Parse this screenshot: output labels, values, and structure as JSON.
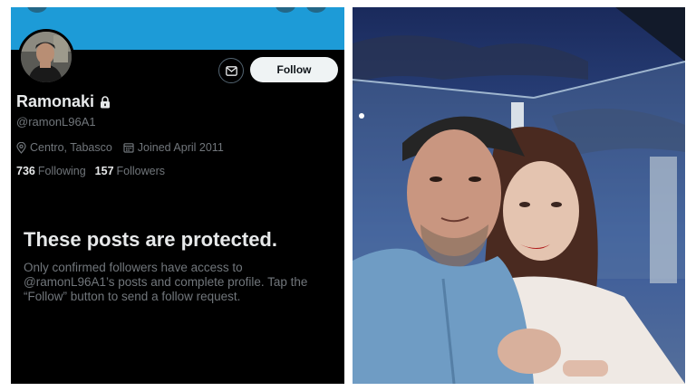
{
  "profile": {
    "display_name": "Ramonaki",
    "handle": "@ramonL96A1",
    "location": "Centro, Tabasco",
    "joined": "Joined April 2011",
    "following_count": "736",
    "following_label": "Following",
    "followers_count": "157",
    "followers_label": "Followers",
    "follow_button_label": "Follow",
    "protected_title": "These posts are protected.",
    "protected_message": "Only confirmed followers have access to @ramonL96A1’s posts and complete profile. Tap the “Follow” button to send a follow request."
  },
  "icons": {
    "lock": "lock-icon",
    "mail": "mail-icon",
    "location": "location-pin-icon",
    "calendar": "calendar-icon"
  },
  "colors": {
    "banner": "#1d9bd7",
    "background": "#000000",
    "primary_text": "#e7e9ea",
    "secondary_text": "#71767b",
    "follow_button": "#eff3f4"
  }
}
